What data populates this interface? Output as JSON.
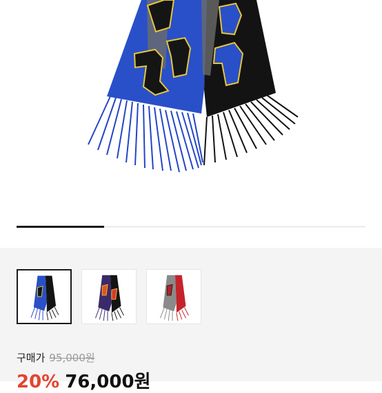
{
  "carousel": {
    "progress_fraction": 0.25
  },
  "thumbnails": [
    {
      "name": "blue-black",
      "selected": true
    },
    {
      "name": "purple-orange",
      "selected": false
    },
    {
      "name": "gray-red",
      "selected": false
    }
  ],
  "price": {
    "label": "구매가",
    "original": "95,000원",
    "discount": "20%",
    "sale": "76,000원"
  },
  "colors": {
    "discount": "#e5432f",
    "background_panel": "#f4f4f5"
  }
}
